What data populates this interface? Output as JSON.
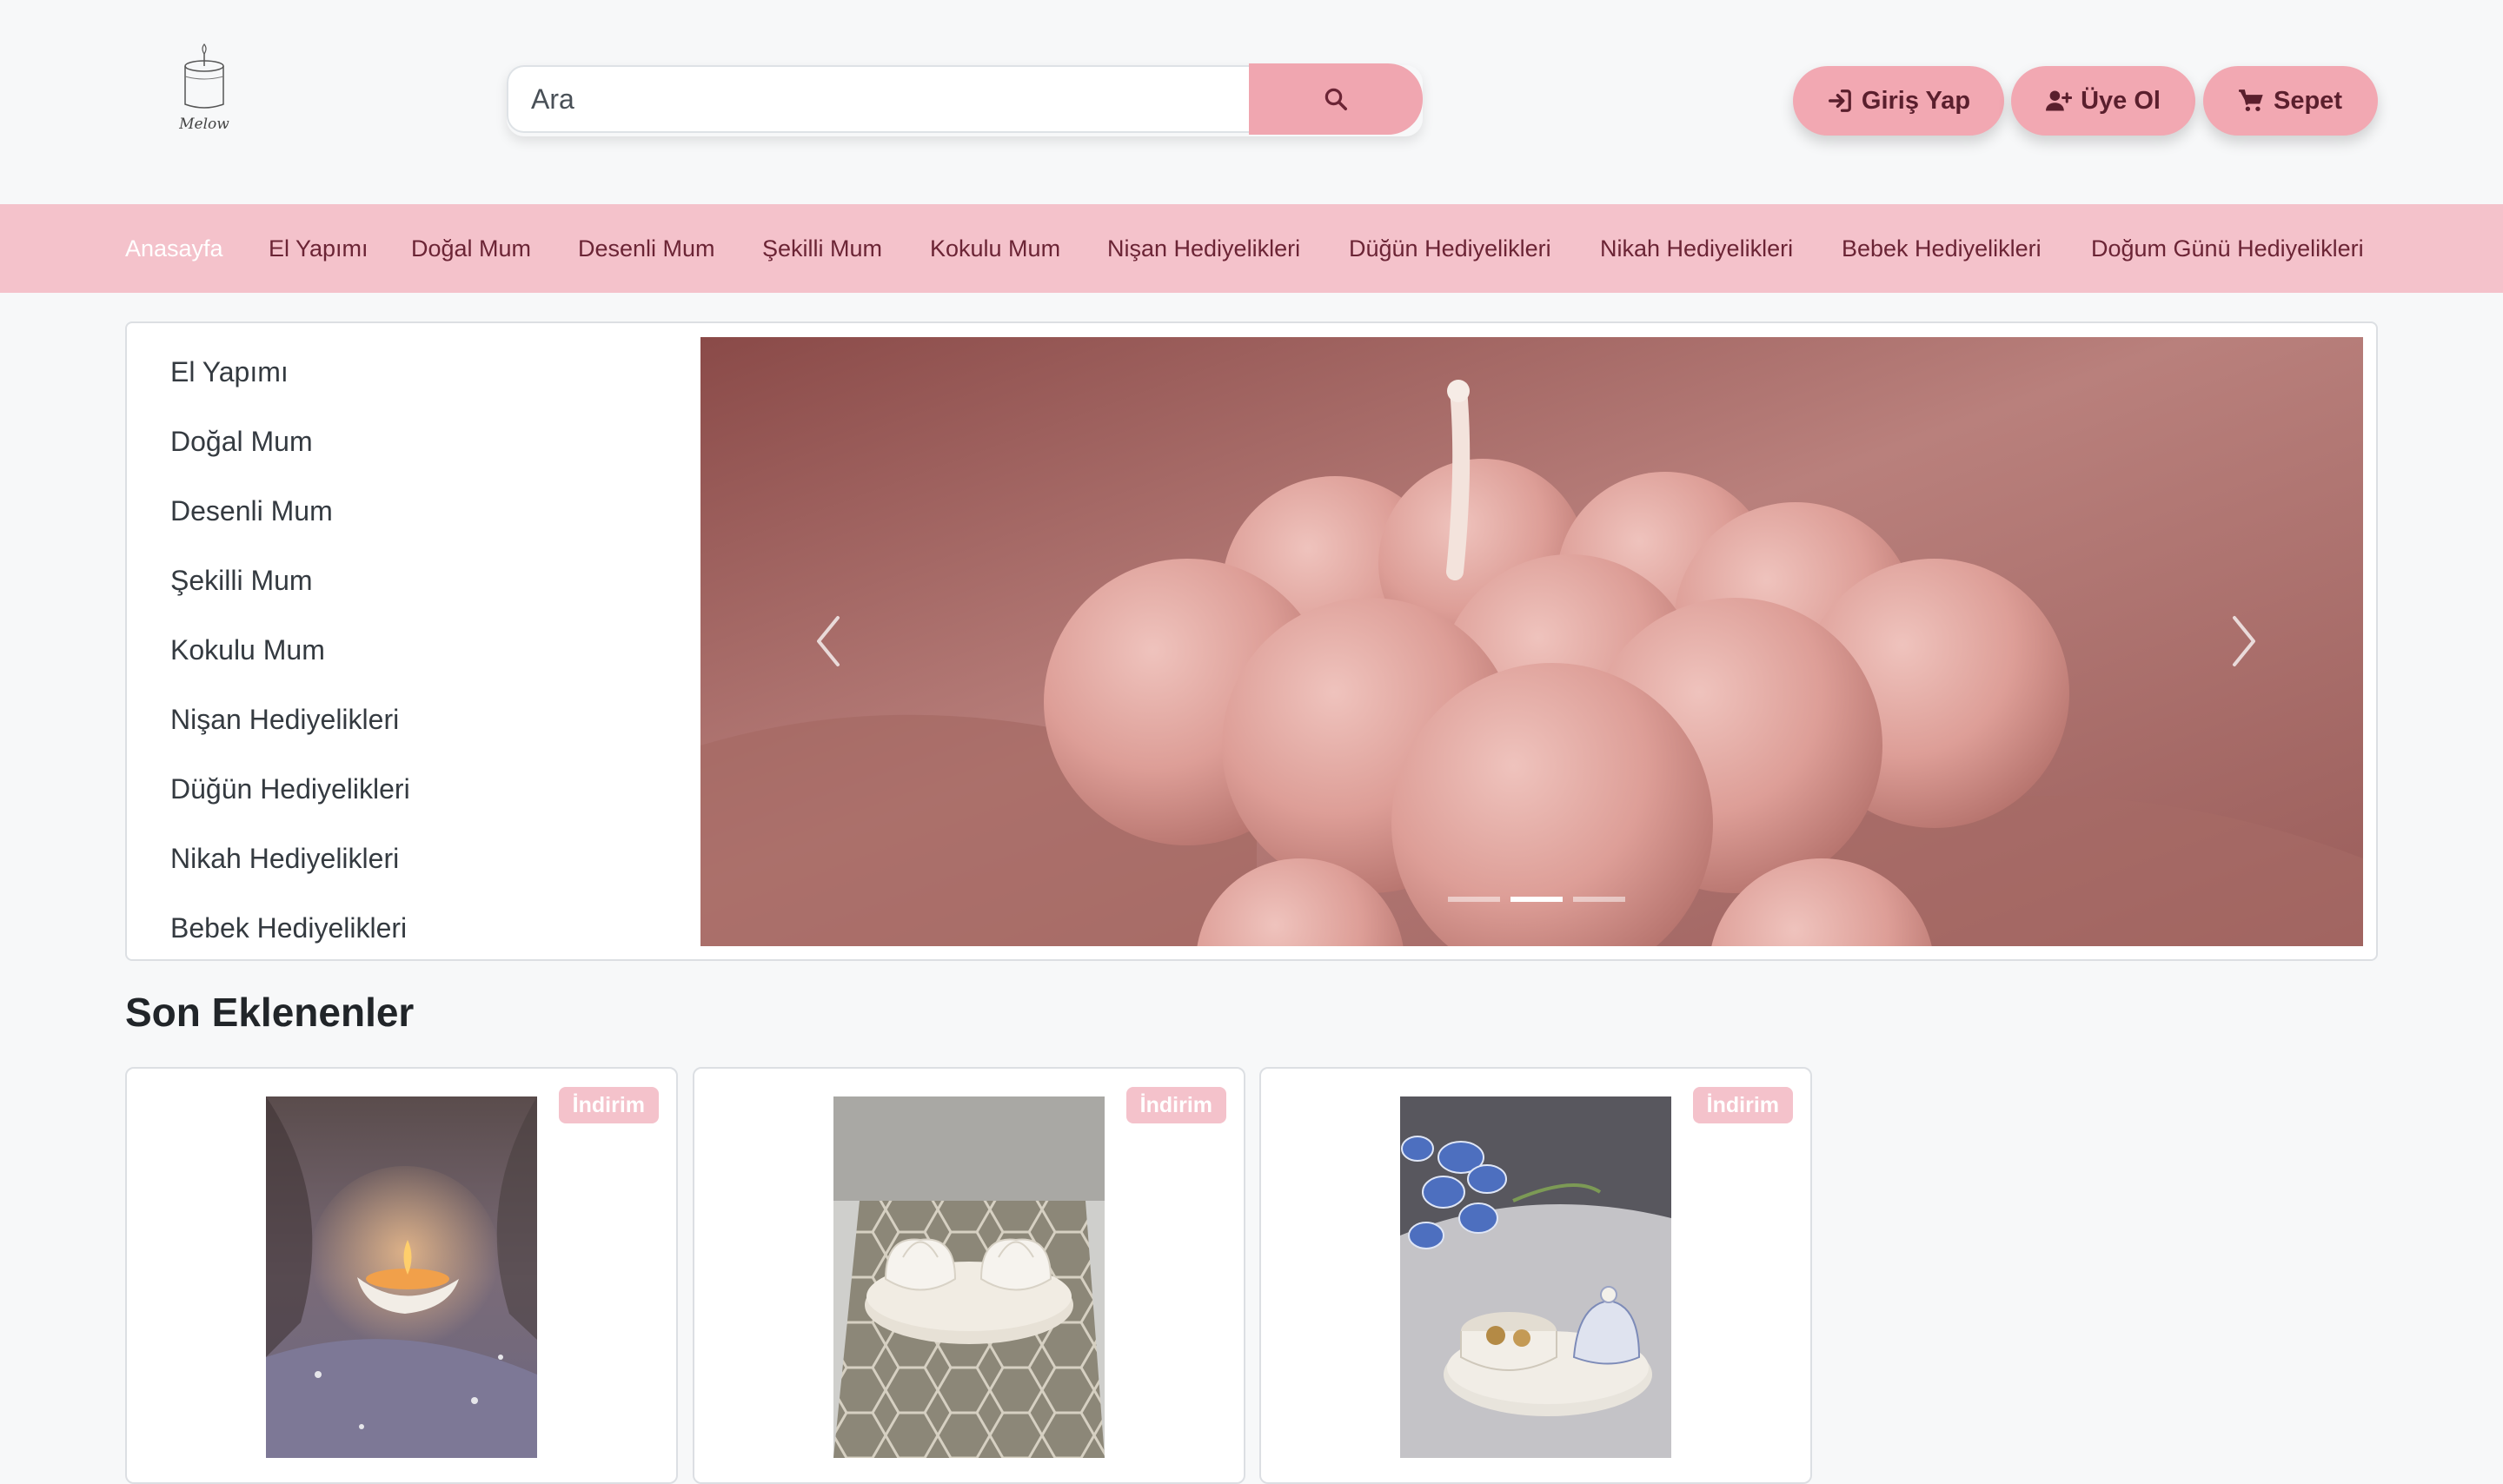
{
  "header": {
    "logo_text": "Melow",
    "search": {
      "placeholder": "Ara",
      "value": ""
    },
    "buttons": {
      "login": "Giriş Yap",
      "register": "Üye Ol",
      "cart": "Sepet"
    }
  },
  "nav": {
    "items": [
      {
        "label": "Anasayfa",
        "active": true
      },
      {
        "label": "El Yapımı"
      },
      {
        "label": "Doğal Mum"
      },
      {
        "label": "Desenli Mum"
      },
      {
        "label": "Şekilli Mum"
      },
      {
        "label": "Kokulu Mum"
      },
      {
        "label": "Nişan Hediyelikleri"
      },
      {
        "label": "Düğün Hediyelikleri"
      },
      {
        "label": "Nikah Hediyelikleri"
      },
      {
        "label": "Bebek Hediyelikleri"
      },
      {
        "label": "Doğum Günü Hediyelikleri"
      }
    ]
  },
  "categories": [
    "El Yapımı",
    "Doğal Mum",
    "Desenli Mum",
    "Şekilli Mum",
    "Kokulu Mum",
    "Nişan Hediyelikleri",
    "Düğün Hediyelikleri",
    "Nikah Hediyelikleri",
    "Bebek Hediyelikleri"
  ],
  "carousel": {
    "slide_count": 3,
    "active_index": 1
  },
  "latest": {
    "title": "Son Eklenenler",
    "products": [
      {
        "badge": "İndirim",
        "image": "lit-shell-candle"
      },
      {
        "badge": "İndirim",
        "image": "lotus-candle-holders"
      },
      {
        "badge": "İndirim",
        "image": "orchid-jar-tray"
      }
    ]
  },
  "colors": {
    "brand_pink": "#f4c2cb",
    "button_pink": "#f2a8b2",
    "nav_text": "#6b2435",
    "page_bg": "#f7f8f9"
  }
}
